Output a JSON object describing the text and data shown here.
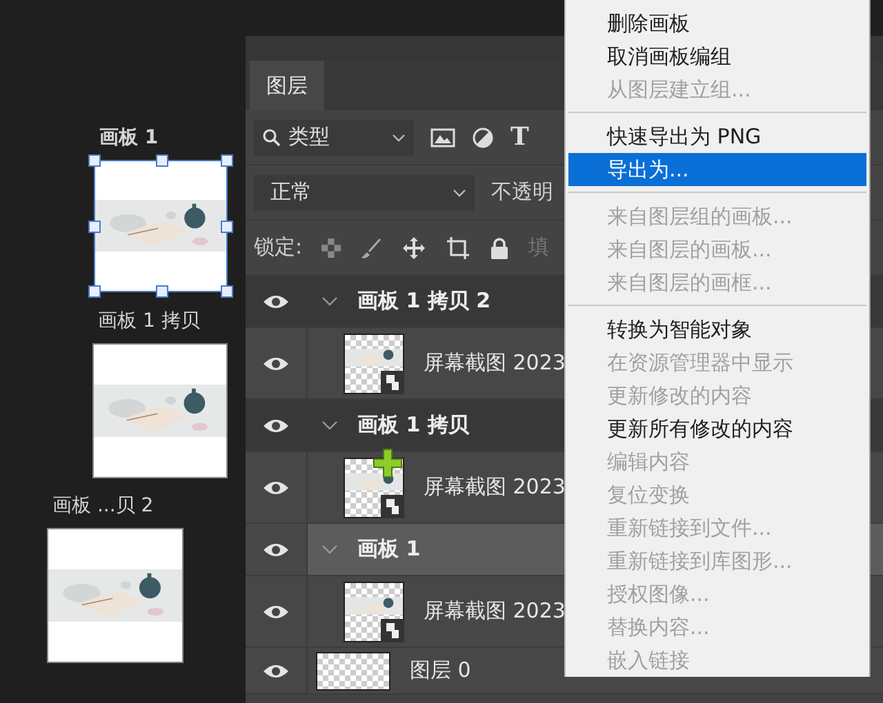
{
  "artboards": [
    {
      "label": "画板 1",
      "selected": true
    },
    {
      "label": "画板 1 拷贝",
      "selected": false
    },
    {
      "label": "画板 ...贝 2",
      "selected": false
    }
  ],
  "panel": {
    "tab": "图层",
    "filter": {
      "value": "类型",
      "type_glyph": "T"
    },
    "blend": {
      "value": "正常",
      "opacity_label": "不透明"
    },
    "lock": {
      "label": "锁定:",
      "fill_label": "填"
    }
  },
  "layers": [
    {
      "kind": "group",
      "name": "画板 1 拷贝 2",
      "visible": true,
      "selected": false,
      "expanded": true
    },
    {
      "kind": "smart",
      "name": "屏幕截图 2023",
      "visible": true,
      "selected": false,
      "cursor": false
    },
    {
      "kind": "group",
      "name": "画板 1 拷贝",
      "visible": true,
      "selected": false,
      "expanded": true
    },
    {
      "kind": "smart",
      "name": "屏幕截图 2023",
      "visible": true,
      "selected": false,
      "cursor": true
    },
    {
      "kind": "group",
      "name": "画板 1",
      "visible": true,
      "selected": true,
      "expanded": true
    },
    {
      "kind": "smart",
      "name": "屏幕截图 2023",
      "visible": true,
      "selected": false,
      "cursor": false
    },
    {
      "kind": "plain",
      "name": "图层 0",
      "visible": true,
      "selected": false
    }
  ],
  "menu": {
    "items": [
      {
        "kind": "item",
        "label": "删除画板",
        "disabled": false,
        "selected": false
      },
      {
        "kind": "item",
        "label": "取消画板编组",
        "disabled": false,
        "selected": false
      },
      {
        "kind": "item",
        "label": "从图层建立组...",
        "disabled": true,
        "selected": false
      },
      {
        "kind": "separator"
      },
      {
        "kind": "item",
        "label": "快速导出为 PNG",
        "disabled": false,
        "selected": false
      },
      {
        "kind": "item",
        "label": "导出为...",
        "disabled": false,
        "selected": true
      },
      {
        "kind": "separator"
      },
      {
        "kind": "item",
        "label": "来自图层组的画板...",
        "disabled": true,
        "selected": false
      },
      {
        "kind": "item",
        "label": "来自图层的画板...",
        "disabled": true,
        "selected": false
      },
      {
        "kind": "item",
        "label": "来自图层的画框...",
        "disabled": true,
        "selected": false
      },
      {
        "kind": "separator"
      },
      {
        "kind": "item",
        "label": "转换为智能对象",
        "disabled": false,
        "selected": false
      },
      {
        "kind": "item",
        "label": "在资源管理器中显示",
        "disabled": true,
        "selected": false
      },
      {
        "kind": "item",
        "label": "更新修改的内容",
        "disabled": true,
        "selected": false
      },
      {
        "kind": "item",
        "label": "更新所有修改的内容",
        "disabled": false,
        "selected": false
      },
      {
        "kind": "item",
        "label": "编辑内容",
        "disabled": true,
        "selected": false
      },
      {
        "kind": "item",
        "label": "复位变换",
        "disabled": true,
        "selected": false
      },
      {
        "kind": "item",
        "label": "重新链接到文件...",
        "disabled": true,
        "selected": false
      },
      {
        "kind": "item",
        "label": "重新链接到库图形...",
        "disabled": true,
        "selected": false
      },
      {
        "kind": "item",
        "label": "授权图像...",
        "disabled": true,
        "selected": false
      },
      {
        "kind": "item",
        "label": "替换内容...",
        "disabled": true,
        "selected": false
      },
      {
        "kind": "item",
        "label": "嵌入链接",
        "disabled": true,
        "selected": false
      }
    ]
  }
}
